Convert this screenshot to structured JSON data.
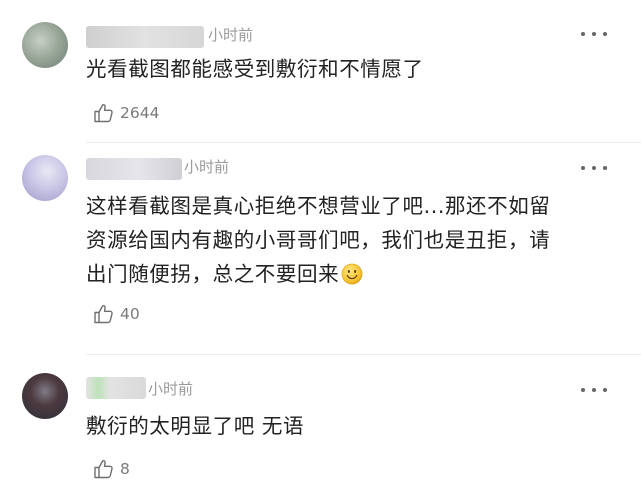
{
  "comments": [
    {
      "time": "小时前",
      "text_lines": [
        "光看截图都能感受到敷衍和不情愿了"
      ],
      "likes": "2644",
      "avatar_colors": [
        "#9aa89a",
        "#6f7d72",
        "#c8cfc6"
      ],
      "name_colors": [
        "#cfcfcf",
        "#e2e2e2",
        "#d6d6d6"
      ]
    },
    {
      "time": "小时前",
      "text_lines": [
        "这样看截图是真心拒绝不想营业了吧...那还不如留",
        "资源给国内有趣的小哥哥们吧，我们也是丑拒，请",
        "出门随便拐，总之不要回来"
      ],
      "likes": "40",
      "avatar_colors": [
        "#c9c6e6",
        "#9e9ac9",
        "#e9e8f4"
      ],
      "name_colors": [
        "#d8d8dc",
        "#e6e6ea",
        "#cfcfd4"
      ]
    },
    {
      "time": "小时前",
      "text_lines": [
        "敷衍的太明显了吧 无语"
      ],
      "likes": "8",
      "avatar_colors": [
        "#2b2f3a",
        "#4c3a3f",
        "#7f7a86"
      ],
      "name_colors": [
        "#bde3b8",
        "#e3e3e3",
        "#d9d9d9"
      ]
    }
  ],
  "icons": {
    "more": "more-dots-icon",
    "like": "thumbs-up-icon",
    "emoji": "smile-emoji-icon"
  }
}
